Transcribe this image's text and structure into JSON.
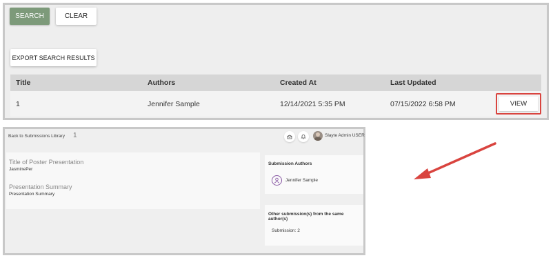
{
  "search_panel": {
    "search_label": "SEARCH",
    "clear_label": "CLEAR",
    "export_label": "EXPORT SEARCH RESULTS",
    "columns": [
      "Title",
      "Authors",
      "Created At",
      "Last Updated"
    ],
    "rows": [
      {
        "title": "1",
        "authors": "Jennifer Sample",
        "created_at": "12/14/2021 5:35 PM",
        "last_updated": "07/15/2022 6:58 PM",
        "action": "VIEW"
      }
    ],
    "highlight_color": "#d9443f",
    "search_button_color": "#7d9a7a"
  },
  "detail_panel": {
    "back_link": "Back to Submissions Library",
    "submission_id": "1",
    "header_icons": [
      "mail-icon",
      "bell-icon"
    ],
    "user_name": "Slayte Admin USER",
    "fields": [
      {
        "label": "Title of Poster Presentation",
        "value": "JasminePer"
      },
      {
        "label": "Presentation Summary",
        "value": "Presentation Summary"
      }
    ],
    "authors_card": {
      "title": "Submission Authors",
      "author": "Jennifer Sample",
      "author_icon": "person-circle-icon"
    },
    "other_card": {
      "title": "Other submission(s) from the same author(s)",
      "item": "Submission: 2"
    }
  },
  "annotation": {
    "arrow_color": "#d9443f"
  }
}
